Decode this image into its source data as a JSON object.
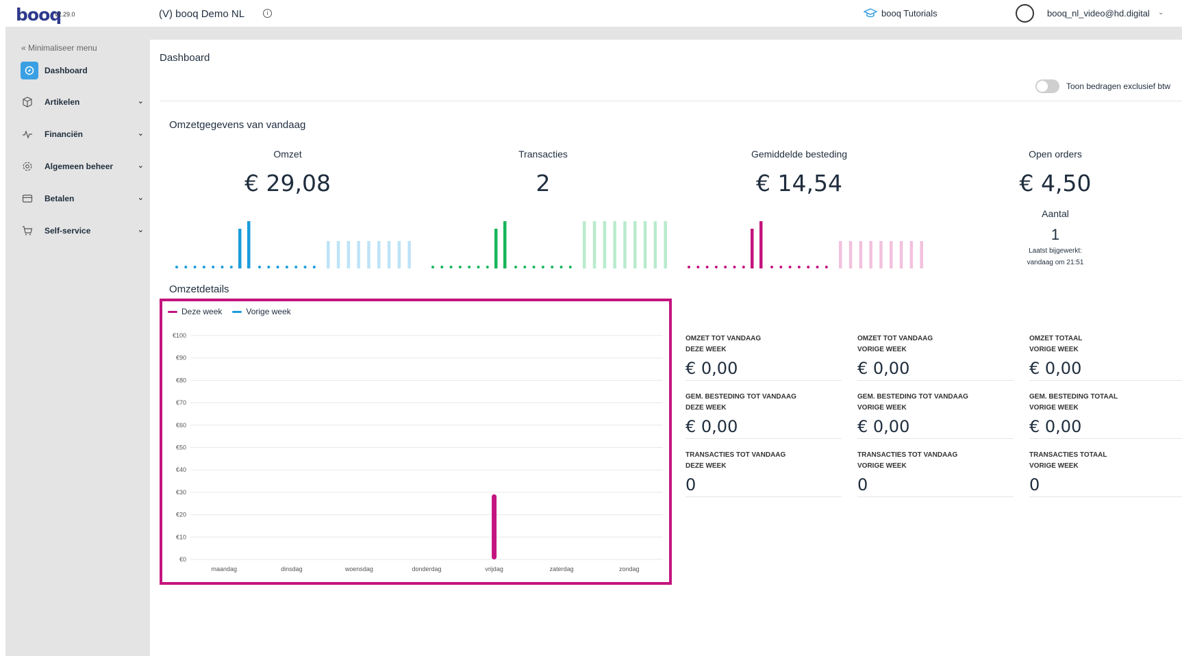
{
  "header": {
    "logo": "booq",
    "version": "v2.29.0",
    "store_name": "(V) booq Demo NL",
    "tutorials_label": "booq Tutorials",
    "user_email": "booq_nl_video@hd.digital"
  },
  "sidebar": {
    "minimize_label": "Minimaliseer menu",
    "items": [
      {
        "label": "Dashboard",
        "icon": "dashboard-icon",
        "active": true
      },
      {
        "label": "Artikelen",
        "icon": "box-icon"
      },
      {
        "label": "Financiën",
        "icon": "pulse-icon"
      },
      {
        "label": "Algemeen beheer",
        "icon": "gear-icon"
      },
      {
        "label": "Betalen",
        "icon": "card-icon"
      },
      {
        "label": "Self-service",
        "icon": "cart-icon"
      }
    ]
  },
  "page": {
    "title": "Dashboard",
    "toggle_label": "Toon bedragen exclusief btw",
    "toggle_on": false
  },
  "today": {
    "section_title": "Omzetgegevens van vandaag",
    "kpis": [
      {
        "label": "Omzet",
        "value": "€ 29,08",
        "color": "#1a9ddb",
        "light": "#bde3f7"
      },
      {
        "label": "Transacties",
        "value": "2",
        "color": "#16b55a",
        "light": "#b9ebcd"
      },
      {
        "label": "Gemiddelde besteding",
        "value": "€ 14,54",
        "color": "#c4147f",
        "light": "#f2c1dd"
      },
      {
        "label": "Open orders",
        "value": "€ 4,50"
      }
    ],
    "open_orders_count_label": "Aantal",
    "open_orders_count": "1",
    "last_updated_line1": "Laatst bijgewerkt:",
    "last_updated_line2": "vandaag om 21:51"
  },
  "details": {
    "section_title": "Omzetdetails",
    "metrics": [
      {
        "label1": "OMZET TOT VANDAAG",
        "label2": "DEZE WEEK",
        "value": "€ 0,00"
      },
      {
        "label1": "OMZET TOT VANDAAG",
        "label2": "VORIGE WEEK",
        "value": "€ 0,00"
      },
      {
        "label1": "OMZET TOTAAL",
        "label2": "VORIGE WEEK",
        "value": "€ 0,00"
      },
      {
        "label1": "GEM. BESTEDING TOT VANDAAG",
        "label2": "DEZE WEEK",
        "value": "€ 0,00"
      },
      {
        "label1": "GEM. BESTEDING TOT VANDAAG",
        "label2": "VORIGE WEEK",
        "value": "€ 0,00"
      },
      {
        "label1": "GEM. BESTEDING TOTAAL",
        "label2": "VORIGE WEEK",
        "value": "€ 0,00"
      },
      {
        "label1": "TRANSACTIES TOT VANDAAG",
        "label2": "DEZE WEEK",
        "value": "0"
      },
      {
        "label1": "TRANSACTIES TOT VANDAAG",
        "label2": "VORIGE WEEK",
        "value": "0"
      },
      {
        "label1": "TRANSACTIES TOTAAL",
        "label2": "VORIGE WEEK",
        "value": "0"
      }
    ]
  },
  "chart_data": {
    "type": "bar",
    "categories": [
      "maandag",
      "dinsdag",
      "woensdag",
      "donderdag",
      "vrijdag",
      "zaterdag",
      "zondag"
    ],
    "series": [
      {
        "name": "Deze week",
        "color": "#c4147f",
        "values": [
          0,
          0,
          0,
          0,
          29.08,
          0,
          0
        ]
      },
      {
        "name": "Vorige week",
        "color": "#1a9ddb",
        "values": [
          0,
          0,
          0,
          0,
          0,
          0,
          0
        ]
      }
    ],
    "yticks": [
      "€0",
      "€10",
      "€20",
      "€30",
      "€40",
      "€50",
      "€60",
      "€70",
      "€80",
      "€90",
      "€100"
    ],
    "ylim": [
      0,
      100
    ],
    "grid": true,
    "legend": "top-left"
  }
}
